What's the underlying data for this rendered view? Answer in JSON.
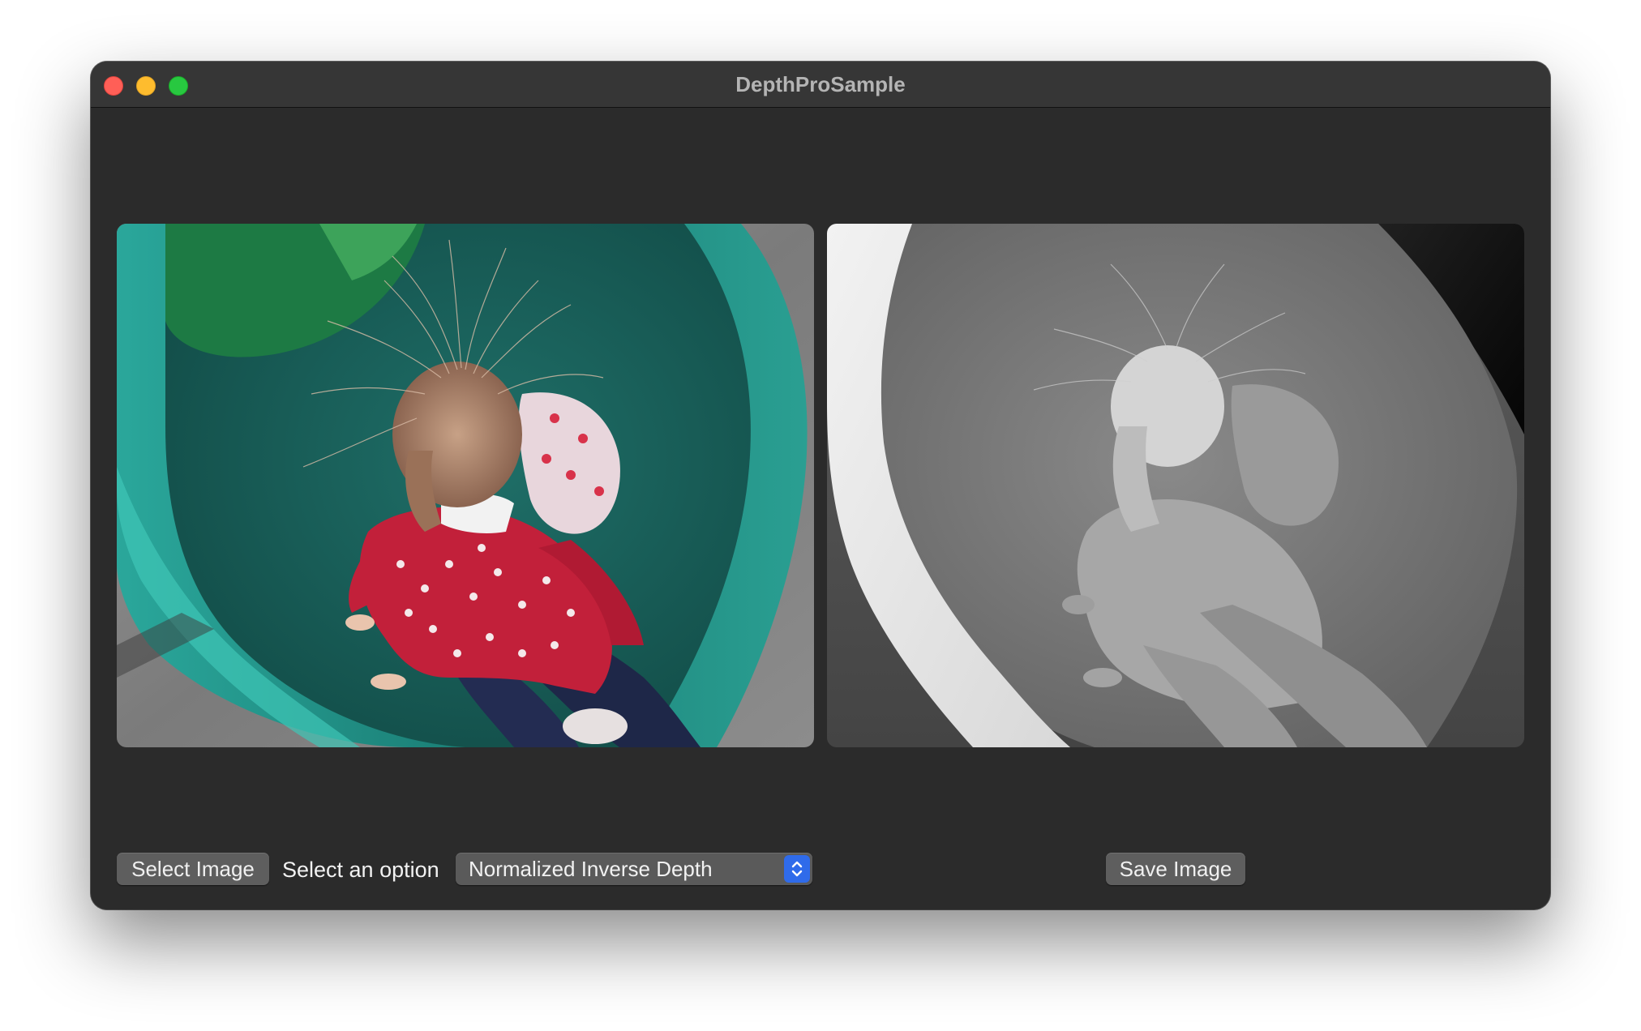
{
  "window": {
    "title": "DepthProSample"
  },
  "images": {
    "input_image": "photo of a child with static-charged hair climbing a green plastic playground slide",
    "output_image": "grayscale depth map of the same scene"
  },
  "toolbar": {
    "select_image_label": "Select Image",
    "option_label": "Select an option",
    "option_selected": "Normalized Inverse Depth",
    "save_image_label": "Save Image"
  },
  "icons": {
    "close": "close-traffic-light",
    "minimize": "minimize-traffic-light",
    "maximize": "maximize-traffic-light",
    "popup": "chevron-up-down-icon"
  },
  "colors": {
    "window_bg": "#2b2b2b",
    "titlebar_bg": "#363636",
    "button_bg": "#5e5e5e",
    "accent": "#2f6bea",
    "close": "#ff5f57",
    "minimize": "#febc2e",
    "maximize": "#28c840"
  }
}
